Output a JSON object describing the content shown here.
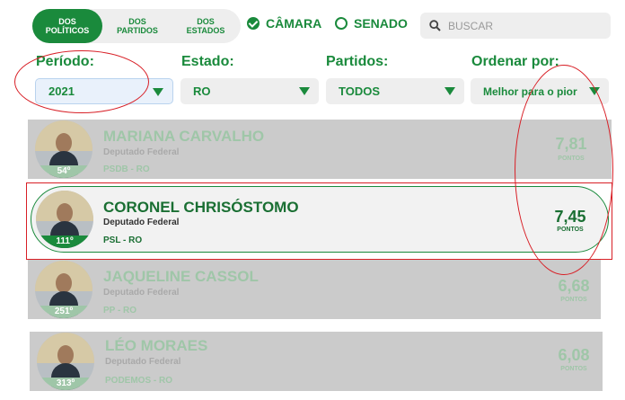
{
  "tabs": [
    {
      "label": "DOS\nPOLÍTICOS",
      "active": true
    },
    {
      "label": "DOS\nPARTIDOS",
      "active": false
    },
    {
      "label": "DOS\nESTADOS",
      "active": false
    }
  ],
  "chamber": {
    "camara_label": "CÂMARA",
    "senado_label": "SENADO",
    "selected": "CÂMARA"
  },
  "search": {
    "placeholder": "BUSCAR"
  },
  "filters": {
    "periodo": {
      "label": "Período:",
      "value": "2021"
    },
    "estado": {
      "label": "Estado:",
      "value": "RO"
    },
    "partidos": {
      "label": "Partidos:",
      "value": "TODOS"
    },
    "ordenar": {
      "label": "Ordenar por:",
      "value": "Melhor para o pior"
    }
  },
  "politicians": [
    {
      "name": "MARIANA CARVALHO",
      "role": "Deputado Federal",
      "party": "PSDB - RO",
      "rank": "54º",
      "score": "7,81",
      "pts": "PONTOS",
      "dimmed": true
    },
    {
      "name": "CORONEL CHRISÓSTOMO",
      "role": "Deputado Federal",
      "party": "PSL - RO",
      "rank": "111º",
      "score": "7,45",
      "pts": "PONTOS",
      "dimmed": false
    },
    {
      "name": "JAQUELINE CASSOL",
      "role": "Deputado Federal",
      "party": "PP - RO",
      "rank": "251º",
      "score": "6,68",
      "pts": "PONTOS",
      "dimmed": true
    },
    {
      "name": "LÉO MORAES",
      "role": "Deputado Federal",
      "party": "PODEMOS - RO",
      "rank": "313º",
      "score": "6,08",
      "pts": "PONTOS",
      "dimmed": true
    }
  ],
  "colors": {
    "brand_green": "#1a8a3c",
    "annotation_red": "#d81f26"
  }
}
